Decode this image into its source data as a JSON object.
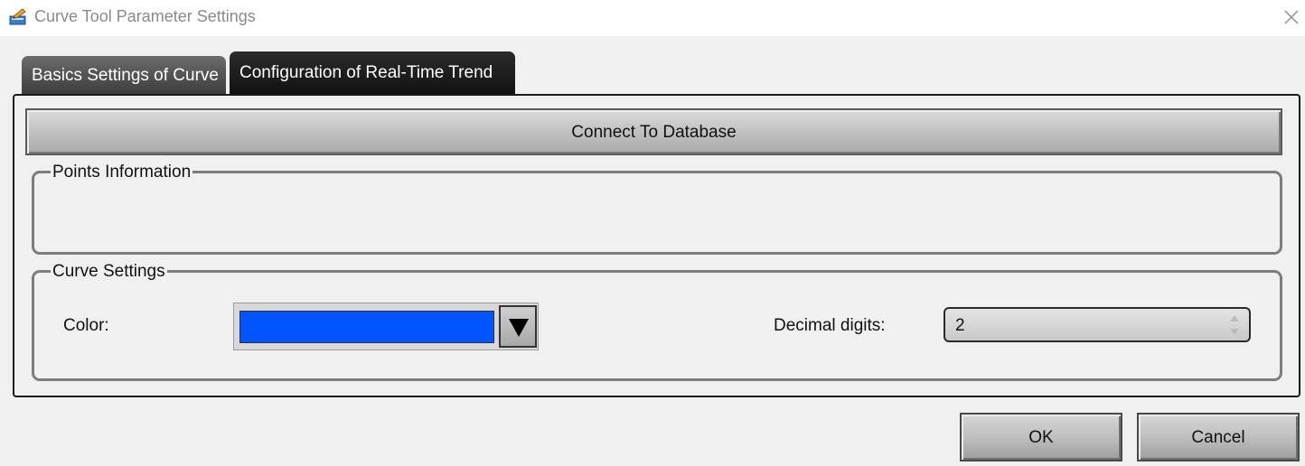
{
  "window": {
    "title": "Curve Tool Parameter Settings"
  },
  "tabs": [
    {
      "label": "Basics Settings of Curve",
      "active": false
    },
    {
      "label": "Configuration of Real-Time Trend",
      "active": true
    }
  ],
  "connect_button": "Connect To Database",
  "points_group": {
    "title": "Points Information"
  },
  "curve_group": {
    "title": "Curve Settings",
    "color_label": "Color:",
    "color_value": "#0055ff",
    "decimal_label": "Decimal digits:",
    "decimal_value": "2"
  },
  "buttons": {
    "ok": "OK",
    "cancel": "Cancel"
  },
  "icons": {
    "app": "pencil-ruler-icon",
    "close": "close-icon",
    "dropdown": "triangle-down-icon",
    "spinner": "up-down-arrows-icon"
  }
}
